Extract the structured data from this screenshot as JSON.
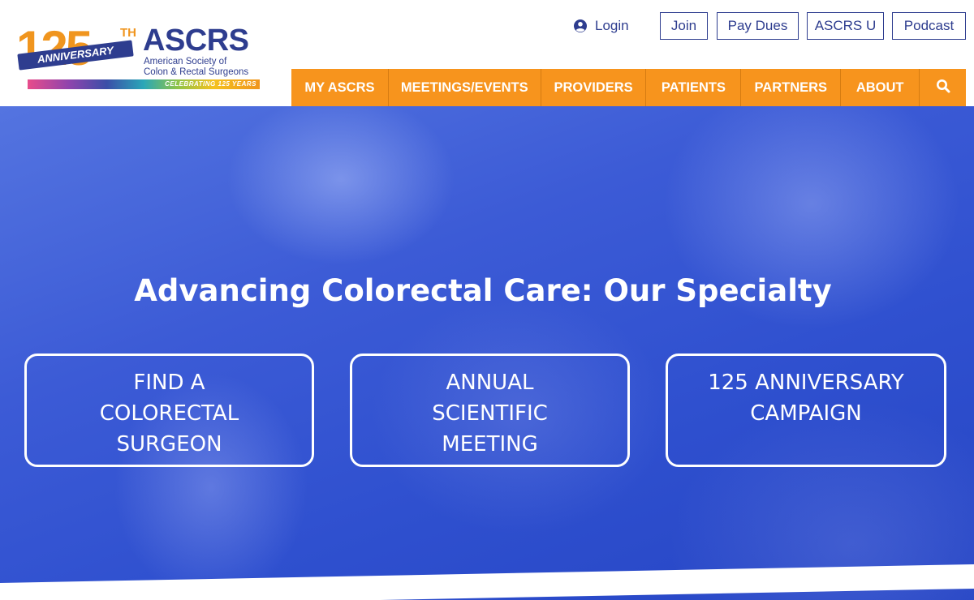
{
  "logo": {
    "number": "125",
    "superscript": "TH",
    "ribbon": "ANNIVERSARY",
    "name": "ASCRS",
    "line1": "American Society of",
    "line2": "Colon & Rectal Surgeons",
    "tagline": "CELEBRATING 125 YEARS"
  },
  "utility": {
    "login": "Login",
    "buttons": [
      "Join",
      "Pay Dues",
      "ASCRS U",
      "Podcast"
    ]
  },
  "nav": {
    "items": [
      "MY ASCRS",
      "MEETINGS/EVENTS",
      "PROVIDERS",
      "PATIENTS",
      "PARTNERS",
      "ABOUT"
    ],
    "search_icon": "search-icon"
  },
  "hero": {
    "title": "Advancing Colorectal Care: Our Specialty",
    "ctas": [
      {
        "lines": [
          "FIND A",
          "COLORECTAL",
          "SURGEON"
        ]
      },
      {
        "lines": [
          "ANNUAL",
          "SCIENTIFIC",
          "MEETING"
        ]
      },
      {
        "lines": [
          "125 ANNIVERSARY",
          "CAMPAIGN"
        ]
      }
    ]
  },
  "colors": {
    "brand_blue": "#2e3d8f",
    "nav_orange": "#f7941d",
    "hero_blue": "#3c5bd6"
  }
}
